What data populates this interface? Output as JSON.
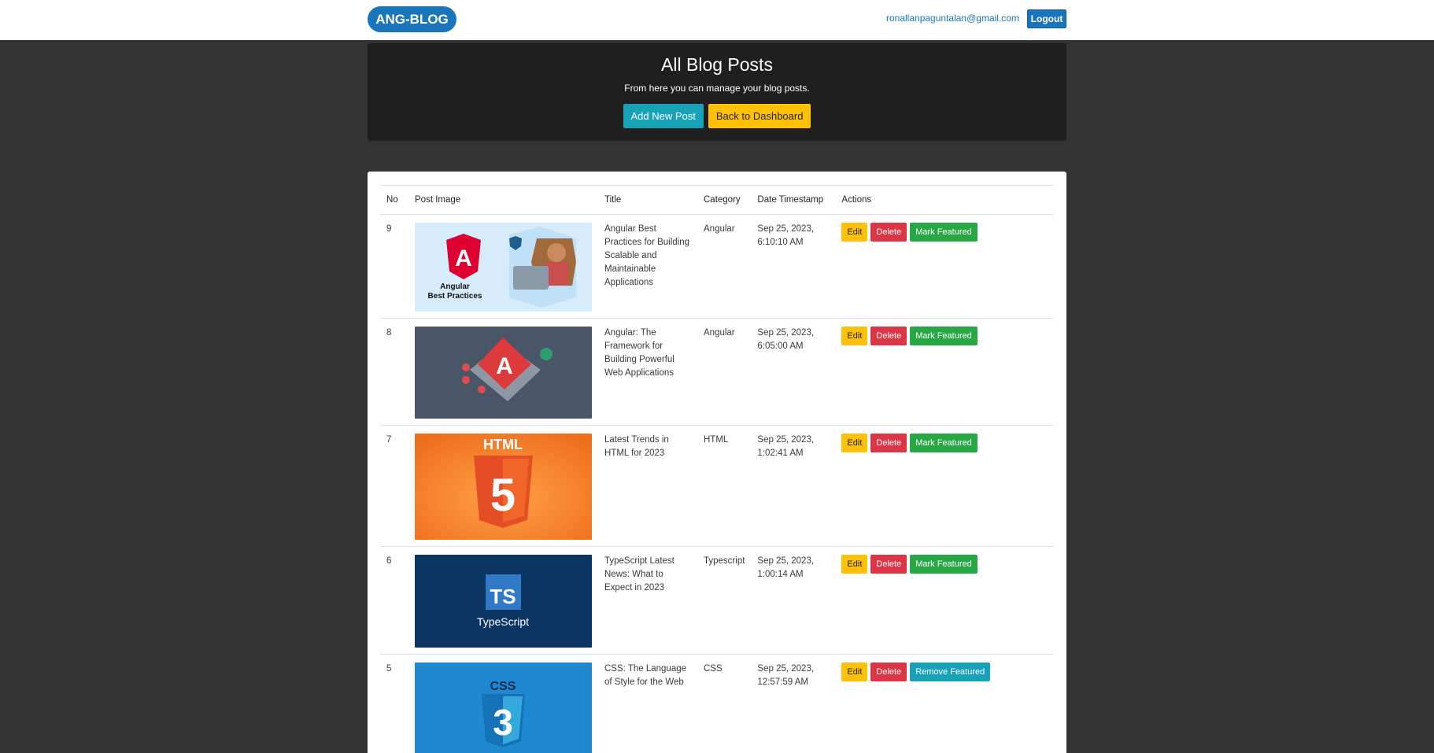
{
  "nav": {
    "brand": "ANG-BLOG",
    "email": "ronallanpaguntalan@gmail.com",
    "logout": "Logout"
  },
  "hero": {
    "title": "All Blog Posts",
    "subtitle": "From here you can manage your blog posts.",
    "add_button": "Add New Post",
    "back_button": "Back to Dashboard"
  },
  "table": {
    "headers": {
      "no": "No",
      "image": "Post Image",
      "title": "Title",
      "category": "Category",
      "timestamp": "Date Timestamp",
      "actions": "Actions"
    },
    "rows": [
      {
        "no": "9",
        "title": "Angular Best Practices for Building Scalable and Maintainable Applications",
        "category": "Angular",
        "date": "Sep 25, 2023,",
        "time": "6:10:10 AM",
        "edit": "Edit",
        "delete": "Delete",
        "feature": "Mark Featured",
        "image_text_1": "Angular",
        "image_text_2": "Best Practices",
        "image_glyph": "A"
      },
      {
        "no": "8",
        "title": "Angular: The Framework for Building Powerful Web Applications",
        "category": "Angular",
        "date": "Sep 25, 2023,",
        "time": "6:05:00 AM",
        "edit": "Edit",
        "delete": "Delete",
        "feature": "Mark Featured",
        "image_glyph": "A"
      },
      {
        "no": "7",
        "title": "Latest Trends in HTML for 2023",
        "category": "HTML",
        "date": "Sep 25, 2023,",
        "time": "1:02:41 AM",
        "edit": "Edit",
        "delete": "Delete",
        "feature": "Mark Featured",
        "image_text_1": "HTML",
        "image_glyph": "5"
      },
      {
        "no": "6",
        "title": "TypeScript Latest News: What to Expect in 2023",
        "category": "Typescript",
        "date": "Sep 25, 2023,",
        "time": "1:00:14 AM",
        "edit": "Edit",
        "delete": "Delete",
        "feature": "Mark Featured",
        "image_text_1": "TypeScript",
        "image_glyph": "TS"
      },
      {
        "no": "5",
        "title": "CSS: The Language of Style for the Web",
        "category": "CSS",
        "date": "Sep 25, 2023,",
        "time": "12:57:59 AM",
        "edit": "Edit",
        "delete": "Delete",
        "feature": "Remove Featured",
        "image_text_1": "CSS",
        "image_glyph": "3"
      }
    ]
  },
  "colors": {
    "primary": "#1b75bb",
    "info": "#17a2b8",
    "warning": "#ffc107",
    "danger": "#dc3545",
    "success": "#28a745",
    "page_bg": "#333333",
    "hero_bg": "#1f1f1f"
  }
}
